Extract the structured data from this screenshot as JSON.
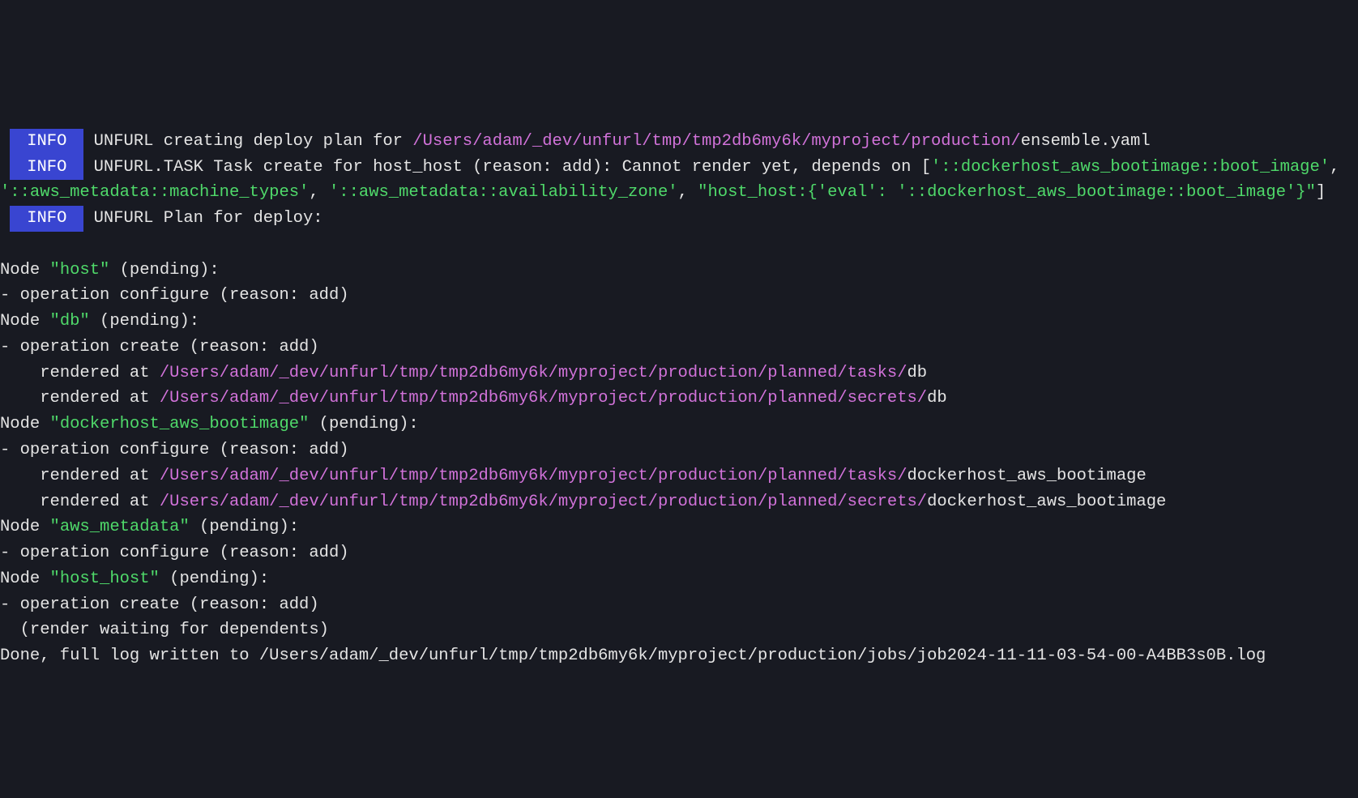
{
  "colors": {
    "bg": "#181a22",
    "fg": "#e4e4e4",
    "level_bg": "#3945d1",
    "path": "#d172d9",
    "string": "#4fd96a"
  },
  "info_label": "INFO",
  "line1": {
    "prefix": "UNFURL creating deploy plan for ",
    "path": "/Users/adam/_dev/unfurl/tmp/tmp2db6my6k/myproject/production/",
    "file": "ensemble.yaml"
  },
  "line2": {
    "prefix": "UNFURL.TASK Task create for host_host (reason: add): Cannot render yet, depends on [",
    "dep1": "'::dockerhost_aws_bootimage::boot_image'",
    "sep": ", ",
    "dep2": "'::aws_metadata::machine_types'",
    "dep3": "'::aws_metadata::availability_zone'",
    "dep4": "\"host_host:{'eval': '::dockerhost_aws_bootimage::boot_image'}\"",
    "suffix": "]"
  },
  "line3": {
    "text": "UNFURL Plan for deploy:"
  },
  "nodes": [
    {
      "name": "host",
      "state": "(pending):",
      "ops": [
        {
          "verb": "configure",
          "reason": "(reason: add)",
          "renders": []
        }
      ]
    },
    {
      "name": "db",
      "state": "(pending):",
      "ops": [
        {
          "verb": "create",
          "reason": "(reason: add)",
          "renders": [
            {
              "path": "/Users/adam/_dev/unfurl/tmp/tmp2db6my6k/myproject/production/planned/tasks/",
              "file": "db"
            },
            {
              "path": "/Users/adam/_dev/unfurl/tmp/tmp2db6my6k/myproject/production/planned/secrets/",
              "file": "db"
            }
          ]
        }
      ]
    },
    {
      "name": "dockerhost_aws_bootimage",
      "state": "(pending):",
      "ops": [
        {
          "verb": "configure",
          "reason": "(reason: add)",
          "renders": [
            {
              "path": "/Users/adam/_dev/unfurl/tmp/tmp2db6my6k/myproject/production/planned/tasks/",
              "file": "dockerhost_aws_bootimage"
            },
            {
              "path": "/Users/adam/_dev/unfurl/tmp/tmp2db6my6k/myproject/production/planned/secrets/",
              "file": "dockerhost_aws_bootimage"
            }
          ]
        }
      ]
    },
    {
      "name": "aws_metadata",
      "state": "(pending):",
      "ops": [
        {
          "verb": "configure",
          "reason": "(reason: add)",
          "renders": []
        }
      ]
    },
    {
      "name": "host_host",
      "state": "(pending):",
      "ops": [
        {
          "verb": "create",
          "reason": "(reason: add)",
          "renders": [],
          "note": "(render waiting for dependents)"
        }
      ]
    }
  ],
  "footer": {
    "prefix": "Done, full log written to ",
    "path": "/Users/adam/_dev/unfurl/tmp/tmp2db6my6k/myproject/production/jobs/job2024-11-11-03-54-00-A4BB3s0B.log"
  },
  "labels": {
    "node": "Node ",
    "op": "- operation ",
    "rendered": "    rendered at ",
    "note_indent": "  "
  }
}
